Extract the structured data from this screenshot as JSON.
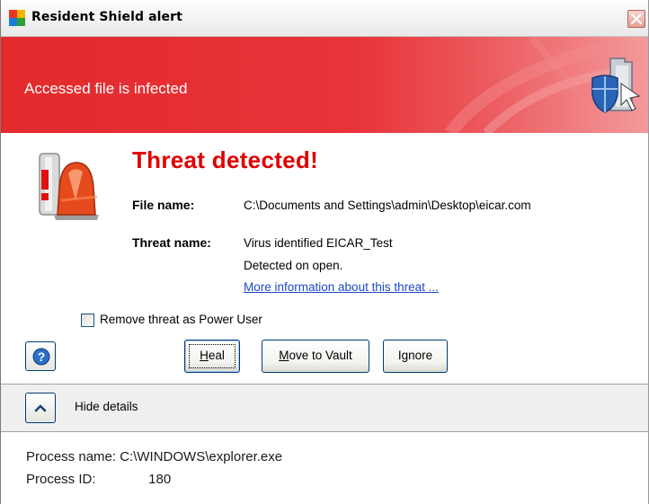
{
  "window": {
    "title": "Resident Shield alert",
    "icons": {
      "app": "avg-logo-icon",
      "close": "close-icon"
    }
  },
  "banner": {
    "text": "Accessed file is infected",
    "icon": "shield-icon",
    "color": "#e32a2c"
  },
  "alert": {
    "headline": "Threat detected!",
    "headline_color": "#e00000",
    "icon": "alarm-siren-icon",
    "file_label": "File name:",
    "file_value": "C:\\Documents and Settings\\admin\\Desktop\\eicar.com",
    "threat_label": "Threat name:",
    "threat_value": "Virus identified EICAR_Test",
    "detected": "Detected on open.",
    "more_info_link": "More information about this threat ..."
  },
  "options": {
    "power_user_label": "Remove threat as Power User",
    "power_user_checked": false
  },
  "buttons": {
    "help_icon": "help-icon",
    "heal": {
      "accel": "H",
      "rest": "eal"
    },
    "vault": {
      "accel": "M",
      "rest": "ove to Vault"
    },
    "ignore": "Ignore"
  },
  "details": {
    "toggle_icon": "chevron-up-icon",
    "toggle_label": "Hide details",
    "process_name_label": "Process name:",
    "process_name": "C:\\WINDOWS\\explorer.exe",
    "process_id_label": "Process ID:",
    "process_id": "180"
  }
}
